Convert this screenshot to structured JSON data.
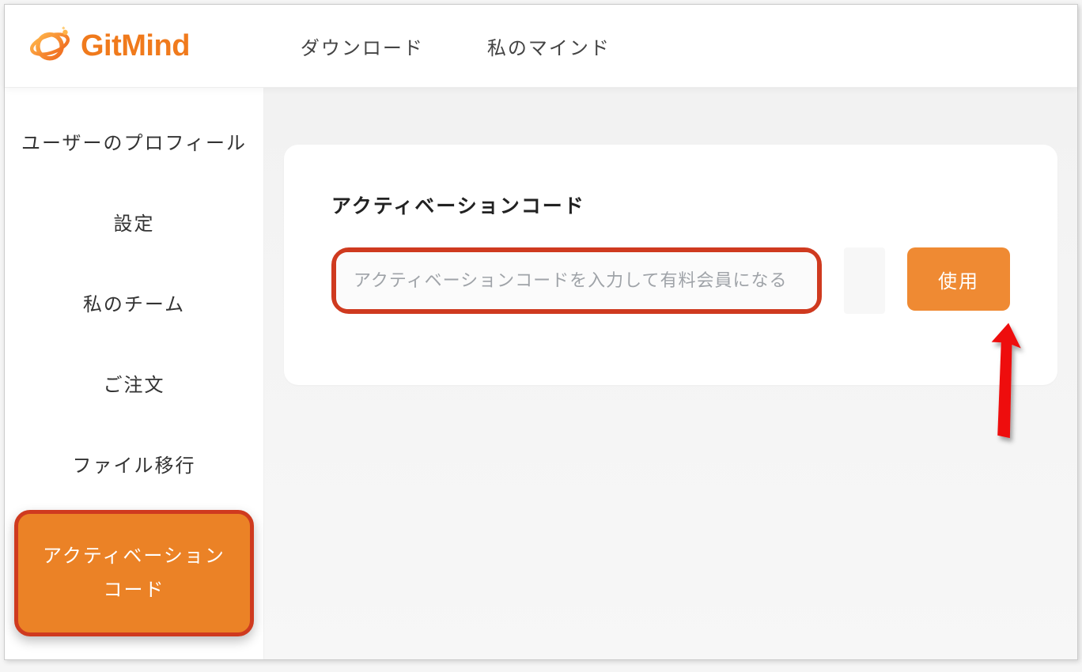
{
  "brand": {
    "name": "GitMind"
  },
  "nav": {
    "download": "ダウンロード",
    "mymind": "私のマインド"
  },
  "sidebar": {
    "profile": "ユーザーのプロフィール",
    "settings": "設定",
    "myteam": "私のチーム",
    "orders": "ご注文",
    "filemigration": "ファイル移行",
    "activation": "アクティベーションコード"
  },
  "card": {
    "title": "アクティベーションコード",
    "placeholder": "アクティベーションコードを入力して有料会員になる",
    "use_label": "使用"
  },
  "colors": {
    "brand_orange": "#f07a1c",
    "btn_orange": "#ef8a33",
    "highlight_red": "#cf3a1f"
  }
}
